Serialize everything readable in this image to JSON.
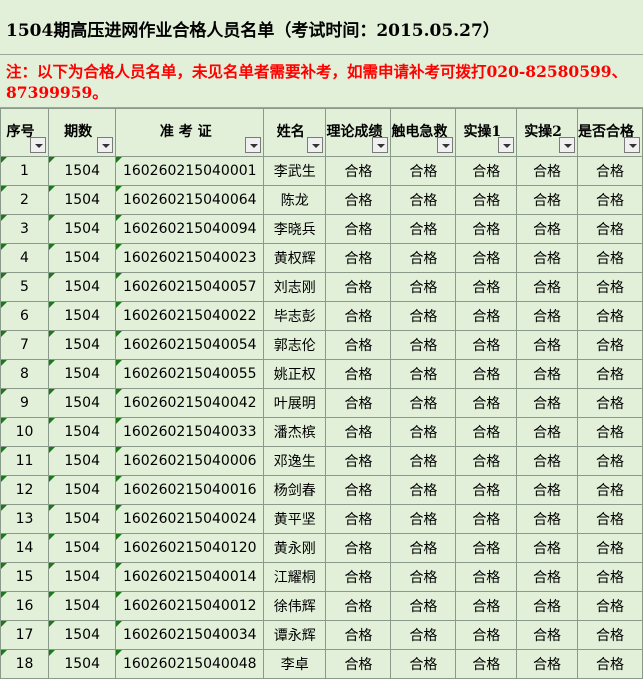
{
  "title": "1504期高压进网作业合格人员名单（考试时间：2015.05.27）",
  "note": "注：以下为合格人员名单，未见名单者需要补考，如需申请补考可拨打020-82580599、87399959。",
  "columns": [
    "序号",
    "期数",
    "准 考 证",
    "姓名",
    "理论成绩",
    "触电急救",
    "实操1",
    "实操2",
    "是否合格"
  ],
  "rows": [
    [
      "1",
      "1504",
      "160260215040001",
      "李武生",
      "合格",
      "合格",
      "合格",
      "合格",
      "合格"
    ],
    [
      "2",
      "1504",
      "160260215040064",
      "陈龙",
      "合格",
      "合格",
      "合格",
      "合格",
      "合格"
    ],
    [
      "3",
      "1504",
      "160260215040094",
      "李晓兵",
      "合格",
      "合格",
      "合格",
      "合格",
      "合格"
    ],
    [
      "4",
      "1504",
      "160260215040023",
      "黄权辉",
      "合格",
      "合格",
      "合格",
      "合格",
      "合格"
    ],
    [
      "5",
      "1504",
      "160260215040057",
      "刘志刚",
      "合格",
      "合格",
      "合格",
      "合格",
      "合格"
    ],
    [
      "6",
      "1504",
      "160260215040022",
      "毕志彭",
      "合格",
      "合格",
      "合格",
      "合格",
      "合格"
    ],
    [
      "7",
      "1504",
      "160260215040054",
      "郭志伦",
      "合格",
      "合格",
      "合格",
      "合格",
      "合格"
    ],
    [
      "8",
      "1504",
      "160260215040055",
      "姚正权",
      "合格",
      "合格",
      "合格",
      "合格",
      "合格"
    ],
    [
      "9",
      "1504",
      "160260215040042",
      "叶展明",
      "合格",
      "合格",
      "合格",
      "合格",
      "合格"
    ],
    [
      "10",
      "1504",
      "160260215040033",
      "潘杰槟",
      "合格",
      "合格",
      "合格",
      "合格",
      "合格"
    ],
    [
      "11",
      "1504",
      "160260215040006",
      "邓逸生",
      "合格",
      "合格",
      "合格",
      "合格",
      "合格"
    ],
    [
      "12",
      "1504",
      "160260215040016",
      "杨剑春",
      "合格",
      "合格",
      "合格",
      "合格",
      "合格"
    ],
    [
      "13",
      "1504",
      "160260215040024",
      "黄平坚",
      "合格",
      "合格",
      "合格",
      "合格",
      "合格"
    ],
    [
      "14",
      "1504",
      "160260215040120",
      "黄永刚",
      "合格",
      "合格",
      "合格",
      "合格",
      "合格"
    ],
    [
      "15",
      "1504",
      "160260215040014",
      "江耀桐",
      "合格",
      "合格",
      "合格",
      "合格",
      "合格"
    ],
    [
      "16",
      "1504",
      "160260215040012",
      "徐伟辉",
      "合格",
      "合格",
      "合格",
      "合格",
      "合格"
    ],
    [
      "17",
      "1504",
      "160260215040034",
      "谭永辉",
      "合格",
      "合格",
      "合格",
      "合格",
      "合格"
    ],
    [
      "18",
      "1504",
      "160260215040048",
      "李卓",
      "合格",
      "合格",
      "合格",
      "合格",
      "合格"
    ]
  ]
}
